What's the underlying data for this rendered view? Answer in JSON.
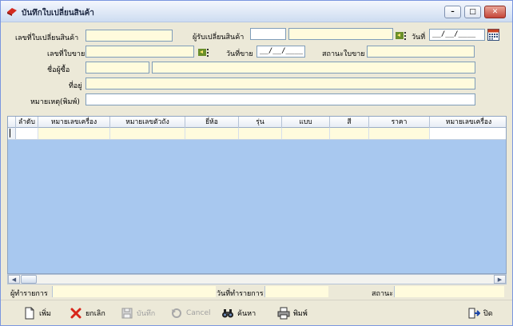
{
  "window": {
    "title": "บันทึกใบเปลี่ยนสินค้า",
    "controls": {
      "minimize": "–",
      "maximize": "□",
      "close": "✕"
    }
  },
  "form": {
    "exchange_no_label": "เลขที่ใบเปลี่ยนสินค้า",
    "exchanger_label": "ผู้รับเปลี่ยนสินค้า",
    "date_label": "วันที่",
    "date_value": "__/__/____",
    "invoice_no_label": "เลขที่ใบขาย",
    "sale_date_label": "วันที่ขาย",
    "sale_date_value": "__/__/____",
    "invoice_status_label": "สถานะใบขาย",
    "buyer_name_label": "ชื่อผู้ซื้อ",
    "address_label": "ที่อยู่",
    "note_label": "หมายเหตุ(พิมพ์)"
  },
  "grid": {
    "columns": [
      "ลำดับ",
      "หมายเลขเครื่อง",
      "หมายเลขตัวถัง",
      "ยี่ห้อ",
      "รุ่น",
      "แบบ",
      "สี",
      "ราคา",
      "หมายเลขเครื่อง"
    ]
  },
  "status": {
    "operator_label": "ผู้ทำรายการ",
    "txn_date_label": "วันที่ทำรายการ",
    "status_label": "สถานะ"
  },
  "toolbar": {
    "add": "เพิ่ม",
    "cancel_doc": "ยกเลิก",
    "save": "บันทึก",
    "cancel": "Cancel",
    "search": "ค้นหา",
    "print": "พิมพ์",
    "close": "ปิด"
  },
  "icons": [
    "app-icon",
    "minimize-icon",
    "maximize-icon",
    "close-icon",
    "lookup-icon",
    "calendar-icon",
    "new-document-icon",
    "delete-x-icon",
    "save-disk-icon",
    "undo-icon",
    "binoculars-icon",
    "printer-icon",
    "exit-door-icon"
  ],
  "colors": {
    "field": "#fffbdd",
    "grid_bg": "#a8c8ef",
    "title_bg": "#dde7f6"
  }
}
